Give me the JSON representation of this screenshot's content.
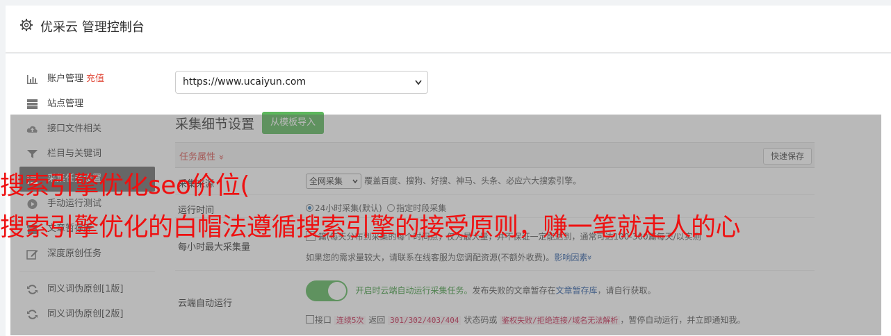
{
  "header": {
    "title": "优采云 管理控制台",
    "icon": "gear-icon"
  },
  "sidebar": {
    "items": [
      {
        "label": "账户管理",
        "badge": "充值",
        "icon": "bar-chart-icon"
      },
      {
        "label": "站点管理",
        "icon": "server-icon"
      },
      {
        "label": "接口文件相关",
        "icon": "cloud-upload-icon"
      },
      {
        "label": "栏目与关键词",
        "icon": "filter-icon"
      },
      {
        "label": "采集任务设置",
        "icon": "list-icon"
      },
      {
        "label": "手动运行测试",
        "icon": "play-icon"
      },
      {
        "label": "文章暂存库",
        "icon": "archive-icon"
      },
      {
        "label": "深度原创任务",
        "icon": "edit-icon"
      },
      {
        "label": "同义词伪原创[1版]",
        "icon": "refresh-icon"
      },
      {
        "label": "同义词伪原创[2版]",
        "icon": "refresh-icon"
      }
    ]
  },
  "main": {
    "site_select": {
      "value": "https://www.ucaiyun.com"
    },
    "section_title": "采集细节设置",
    "template_button": "从模板导入",
    "task_attr": "任务属性",
    "task_attr_chevron": "»",
    "quick_save": "快速保存",
    "rows": {
      "source": {
        "label": "采集来源",
        "select_value": "全网采集",
        "desc": "覆盖百度、搜狗、好搜、神马、头条、必应六大搜索引擎。"
      },
      "runtime": {
        "label": "运行时间",
        "opt1": "24小时采集(默认)",
        "opt2": "指定时段采集"
      },
      "max": {
        "label": "每小时最大采集量",
        "line1": "篇(每天分布到采集的每个时间点，仅为最大量，并不保证一定能达到，通常可达100-300篇每天/以实测",
        "line2": "如果您的需求量较大，请联系在线客服为您调配资源(不额外收费)。",
        "link": "影响因素",
        "link_chevron": "»"
      },
      "cloud": {
        "label": "云端自动运行",
        "text_green": "开启时云端自动运行采集任务。",
        "text_mid": "发布失败的文章暂存在",
        "link": "文章暂存库",
        "text_end": "，请自行获取。",
        "check_a": "接口",
        "code1": "连续5次",
        "t2": "返回",
        "code2": "301/302/403/404",
        "t3": "状态码或",
        "code3": "鉴权失败/拒绝连接/域名无法解析",
        "t4": "，暂停自动运行，并立即通知我。"
      }
    }
  },
  "overlay": {
    "line1": "搜索引擎优化seo价位(",
    "line2": "搜索引擎优化的白帽法遵循搜索引擎的接受原则，赚一笔就走人的心"
  },
  "colors": {
    "accent_green": "#5cb85c",
    "warn_red": "#d9534f",
    "overlay_text": "#ee1111"
  }
}
